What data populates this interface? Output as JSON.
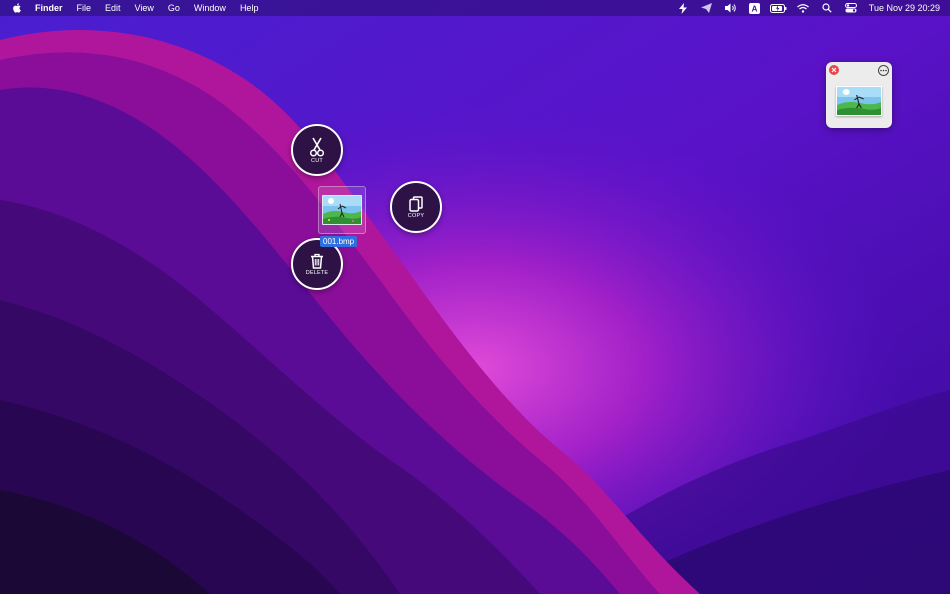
{
  "menubar": {
    "app_name": "Finder",
    "menus": [
      "File",
      "Edit",
      "View",
      "Go",
      "Window",
      "Help"
    ],
    "status_icons": [
      "bolt-icon",
      "send-icon",
      "volume-icon",
      "input-source-icon",
      "battery-icon",
      "wifi-icon",
      "search-icon",
      "control-center-icon"
    ],
    "input_source_label": "A",
    "clock": "Tue Nov 29  20:29"
  },
  "actions": {
    "cut": {
      "label": "CUT",
      "icon": "scissors-icon"
    },
    "copy": {
      "label": "COPY",
      "icon": "copy-icon"
    },
    "delete": {
      "label": "DELETE",
      "icon": "trash-icon"
    }
  },
  "file": {
    "name": "001.bmp",
    "icon": "image-thumbnail-icon"
  },
  "shelf": {
    "close_icon": "close-icon",
    "more_icon": "more-icon",
    "thumbnail_icon": "image-thumbnail-icon"
  },
  "colors": {
    "accent": "#2f6fe0",
    "close_red": "#e8454a",
    "wallpaper_magenta": "#c21aa8",
    "wallpaper_deep": "#1c0836"
  }
}
